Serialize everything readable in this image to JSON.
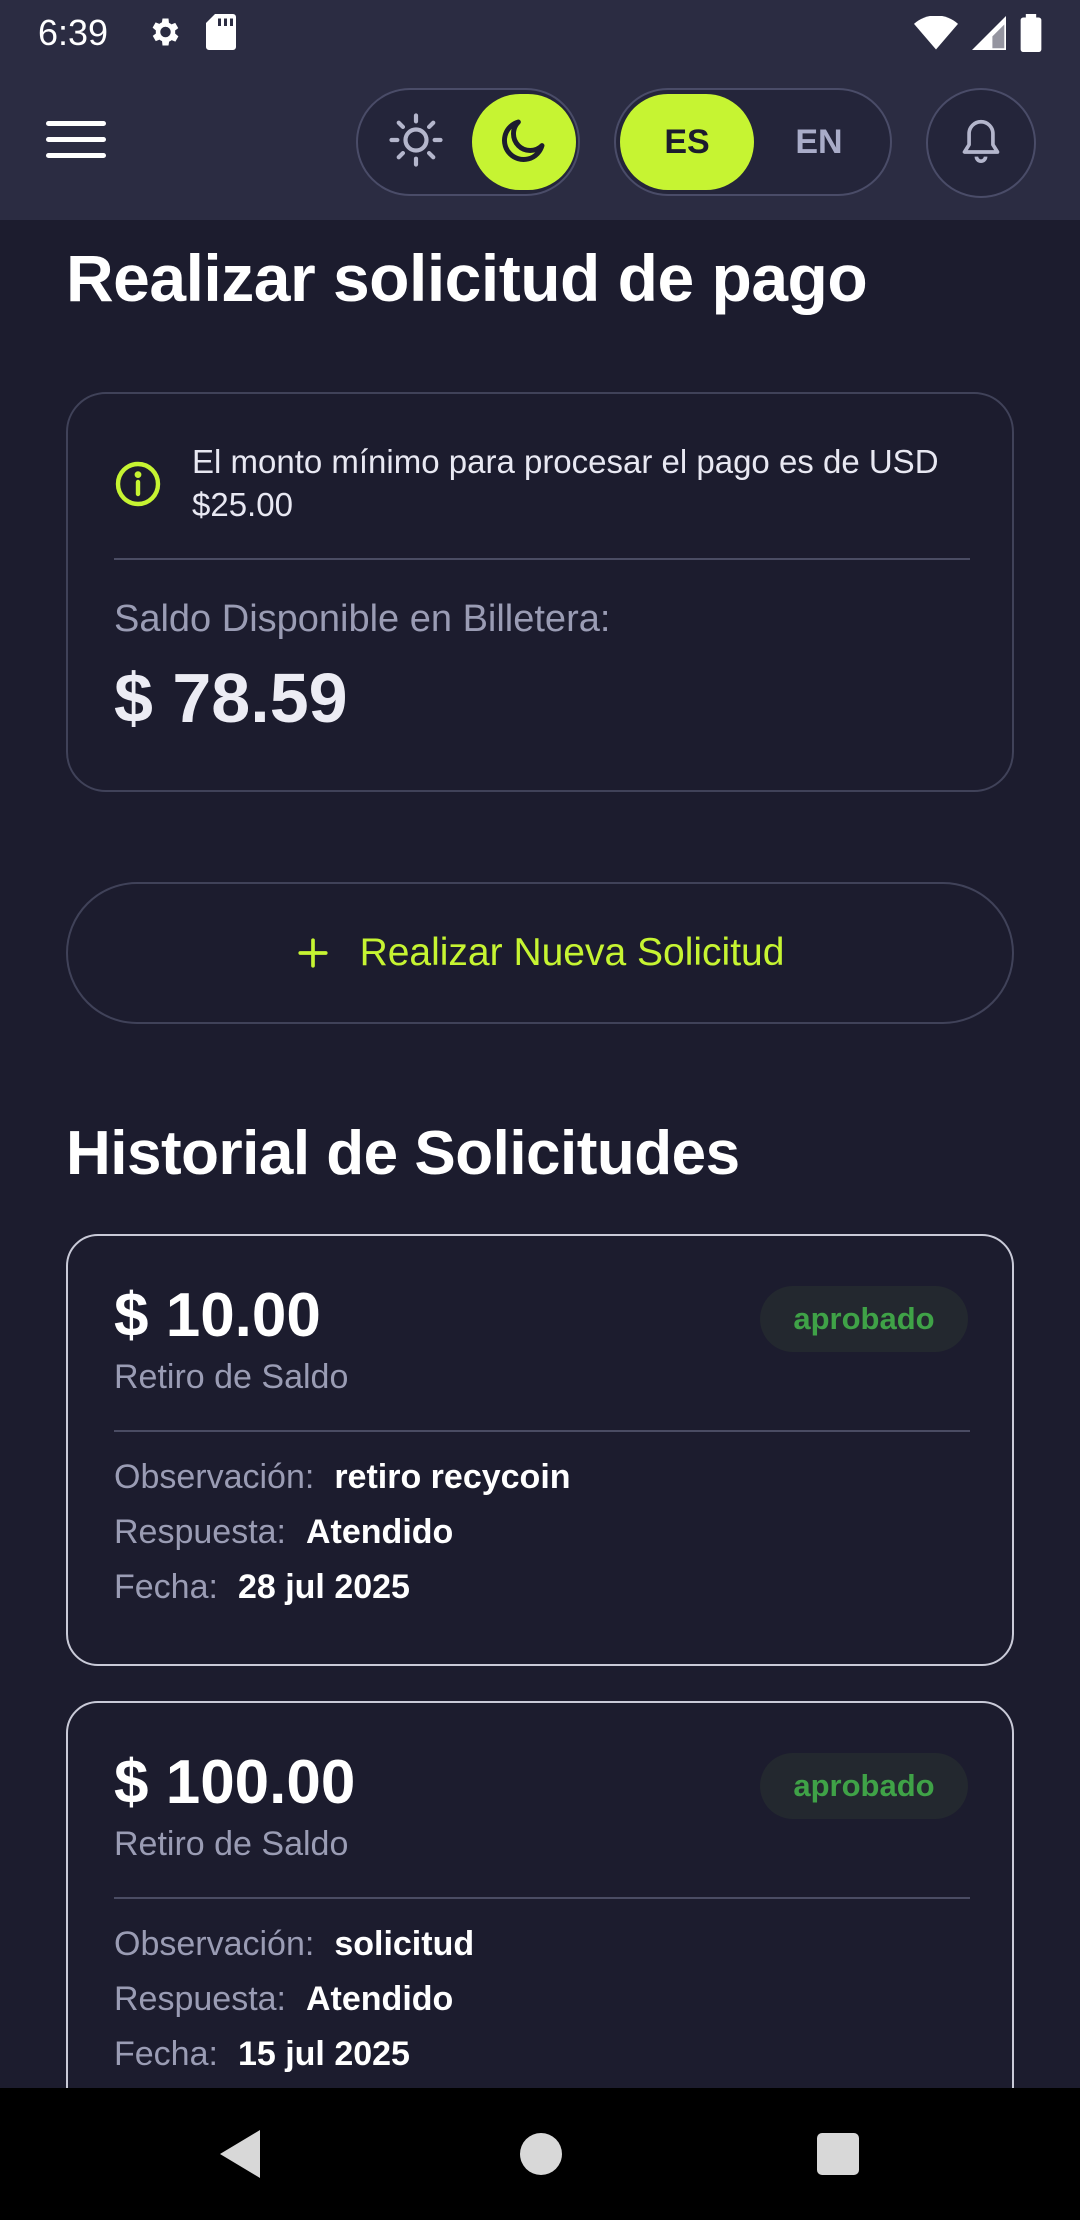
{
  "status_bar": {
    "time": "6:39",
    "icons": [
      "gear-icon",
      "sd-card-icon",
      "wifi-icon",
      "signal-icon",
      "battery-icon"
    ]
  },
  "app_bar": {
    "menu_icon": "hamburger-menu-icon",
    "theme_toggle": {
      "options": [
        "sun-icon",
        "moon-icon"
      ],
      "selected": "moon-icon"
    },
    "language_toggle": {
      "options": [
        "ES",
        "EN"
      ],
      "selected": "ES"
    },
    "notifications_icon": "bell-icon"
  },
  "page": {
    "title": "Realizar solicitud de pago",
    "info_message": "El monto mínimo para procesar el pago es de USD $25.00",
    "balance_label": "Saldo Disponible en Billetera:",
    "balance_amount": "$ 78.59",
    "new_request_label": "Realizar Nueva Solicitud",
    "new_request_icon": "plus-icon"
  },
  "history": {
    "title": "Historial de Solicitudes",
    "labels": {
      "observation": "Observación:",
      "response": "Respuesta:",
      "date": "Fecha:"
    },
    "requests": [
      {
        "amount": "$ 10.00",
        "type": "Retiro de Saldo",
        "status": "aprobado",
        "observation": "retiro recycoin",
        "response": "Atendido",
        "date": "28 jul 2025"
      },
      {
        "amount": "$ 100.00",
        "type": "Retiro de Saldo",
        "status": "aprobado",
        "observation": "solicitud",
        "response": "Atendido",
        "date": "15 jul 2025"
      }
    ]
  },
  "colors": {
    "background": "#1c1c2e",
    "header": "#2b2c42",
    "accent": "#c6f432",
    "approved_text": "#3fa247"
  },
  "nav_bar": {
    "icons": [
      "back-icon",
      "home-icon",
      "recents-icon"
    ]
  }
}
